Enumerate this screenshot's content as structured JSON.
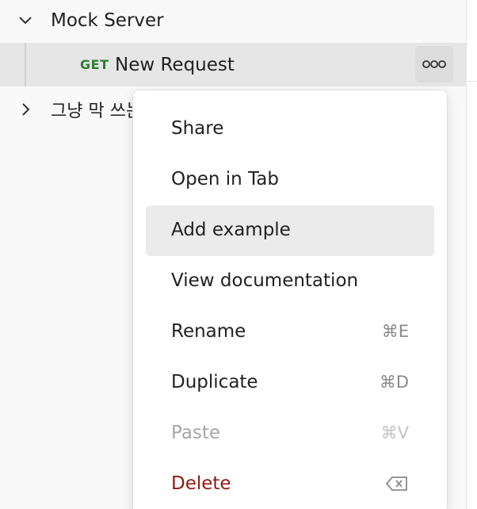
{
  "tree": {
    "collection": {
      "label": "Mock Server",
      "chevron": "chevron-down-icon"
    },
    "request": {
      "method": "GET",
      "label": "New Request",
      "more_icon": "more-horizontal-icon"
    },
    "folder": {
      "label": "그냥 막 쓰는 폴더",
      "chevron": "chevron-right-icon"
    }
  },
  "context_menu": {
    "items": [
      {
        "label": "Share",
        "shortcut": ""
      },
      {
        "label": "Open in Tab",
        "shortcut": ""
      },
      {
        "label": "Add example",
        "shortcut": ""
      },
      {
        "label": "View documentation",
        "shortcut": ""
      },
      {
        "label": "Rename",
        "shortcut": "⌘E"
      },
      {
        "label": "Duplicate",
        "shortcut": "⌘D"
      },
      {
        "label": "Paste",
        "shortcut": "⌘V"
      },
      {
        "label": "Delete",
        "shortcut": ""
      }
    ],
    "highlighted_item": "Add example",
    "disabled_item": "Paste",
    "danger_item": "Delete",
    "delete_shortcut_icon": "backspace-icon"
  },
  "colors": {
    "get_method": "#2f7d32",
    "danger": "#8e1a10",
    "hover": "#ebebeb",
    "selected_row": "#e6e6e6"
  }
}
